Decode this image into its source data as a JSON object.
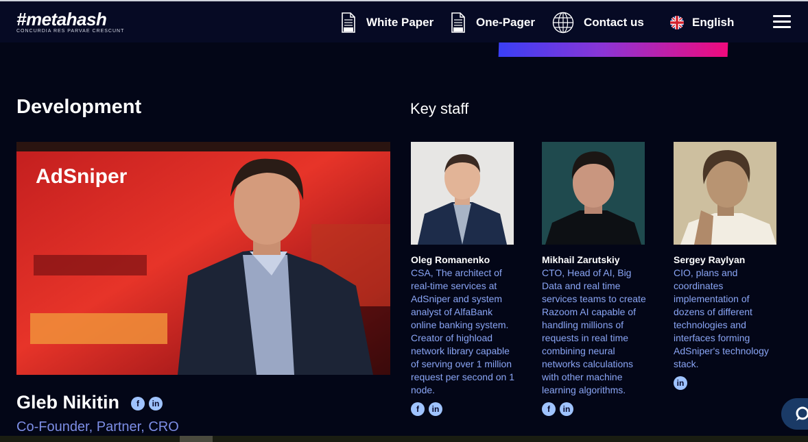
{
  "header": {
    "logo_text": "#metahash",
    "logo_tagline": "CONCURDIA RES PARVAE CRESCUNT",
    "nav": {
      "white_paper": "White Paper",
      "one_pager": "One-Pager",
      "contact": "Contact us",
      "language": "English"
    },
    "icons": {
      "white_paper": "pdf-icon",
      "one_pager": "pdf-icon",
      "contact": "globe-icon",
      "language": "uk-flag-icon",
      "menu": "hamburger-menu-icon"
    }
  },
  "development": {
    "title": "Development",
    "photo_brand": "AdSniper",
    "name": "Gleb Nikitin",
    "role": "Co-Founder, Partner, CRO"
  },
  "key_staff": {
    "title": "Key staff",
    "members": [
      {
        "name": "Oleg Romanenko",
        "description": "CSA, The architect of real-time services at AdSniper and system analyst of AlfaBank online banking system. Creator of highload network library capable of serving over 1 million request per second on 1 node.",
        "social": [
          "facebook",
          "linkedin"
        ]
      },
      {
        "name": "Mikhail Zarutskiy",
        "description": "CTO, Head of AI, Big Data and real time services teams to create Razoom AI capable of handling millions of requests in real time combining neural networks calculations with other machine learning algorithms.",
        "social": [
          "facebook",
          "linkedin"
        ]
      },
      {
        "name": "Sergey Raylyan",
        "description": "CIO, plans and coordinates implementation of dozens of different technologies and interfaces forming AdSniper's technology stack.",
        "social": [
          "linkedin"
        ]
      }
    ]
  },
  "social_glyphs": {
    "facebook": "f",
    "linkedin": "in"
  },
  "colors": {
    "background": "#030617",
    "header": "#060a24",
    "accent_text": "#8aa5f5",
    "gradient_start": "#3a3ff5",
    "gradient_end": "#f00a7c"
  }
}
